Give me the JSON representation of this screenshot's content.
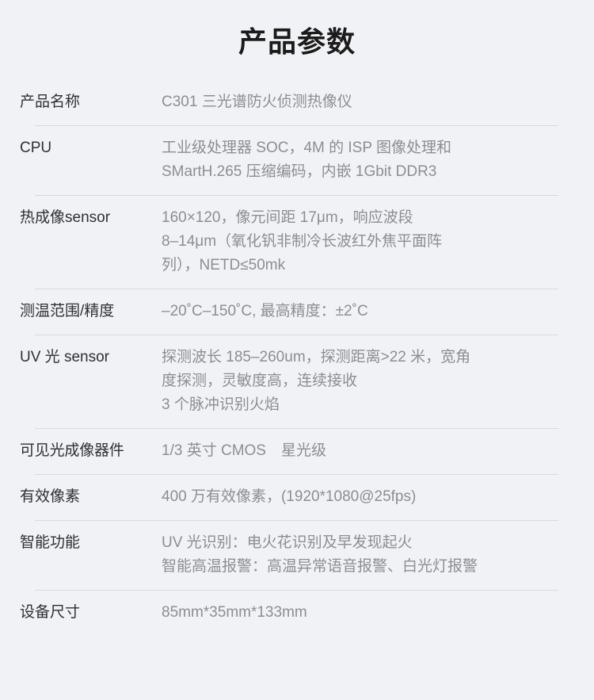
{
  "header": {
    "title": "产品参数"
  },
  "colors": {
    "background": "#f1f2f5",
    "title_text": "#1b1b1b",
    "label_text": "#2f3034",
    "value_text": "#8b8e94",
    "divider": "#d8dade"
  },
  "spec_table": {
    "rows": [
      {
        "label": "产品名称",
        "value": "C301 三光谱防火侦测热像仪"
      },
      {
        "label": "CPU",
        "value": "工业级处理器 SOC，4M 的 ISP 图像处理和\nSMartH.265 压缩编码，内嵌 1Gbit DDR3"
      },
      {
        "label": "热成像sensor",
        "value": "160×120，像元间距 17μm，响应波段\n8–14μm（氧化钒非制冷长波红外焦平面阵\n列），NETD≤50mk"
      },
      {
        "label": "测温范围/精度",
        "value": "–20˚C–150˚C, 最高精度：±2˚C"
      },
      {
        "label": "UV 光 sensor",
        "value": "探测波长 185–260um，探测距离>22 米，宽角\n度探测，灵敏度高，连续接收\n3 个脉冲识别火焰"
      },
      {
        "label": "可见光成像器件",
        "value": "1/3 英寸 CMOS　星光级"
      },
      {
        "label": "有效像素",
        "value": "400 万有效像素，(1920*1080@25fps)"
      },
      {
        "label": "智能功能",
        "value": "UV 光识别：电火花识别及早发现起火\n智能高温报警：高温异常语音报警、白光灯报警"
      },
      {
        "label": "设备尺寸",
        "value": "85mm*35mm*133mm"
      }
    ]
  }
}
